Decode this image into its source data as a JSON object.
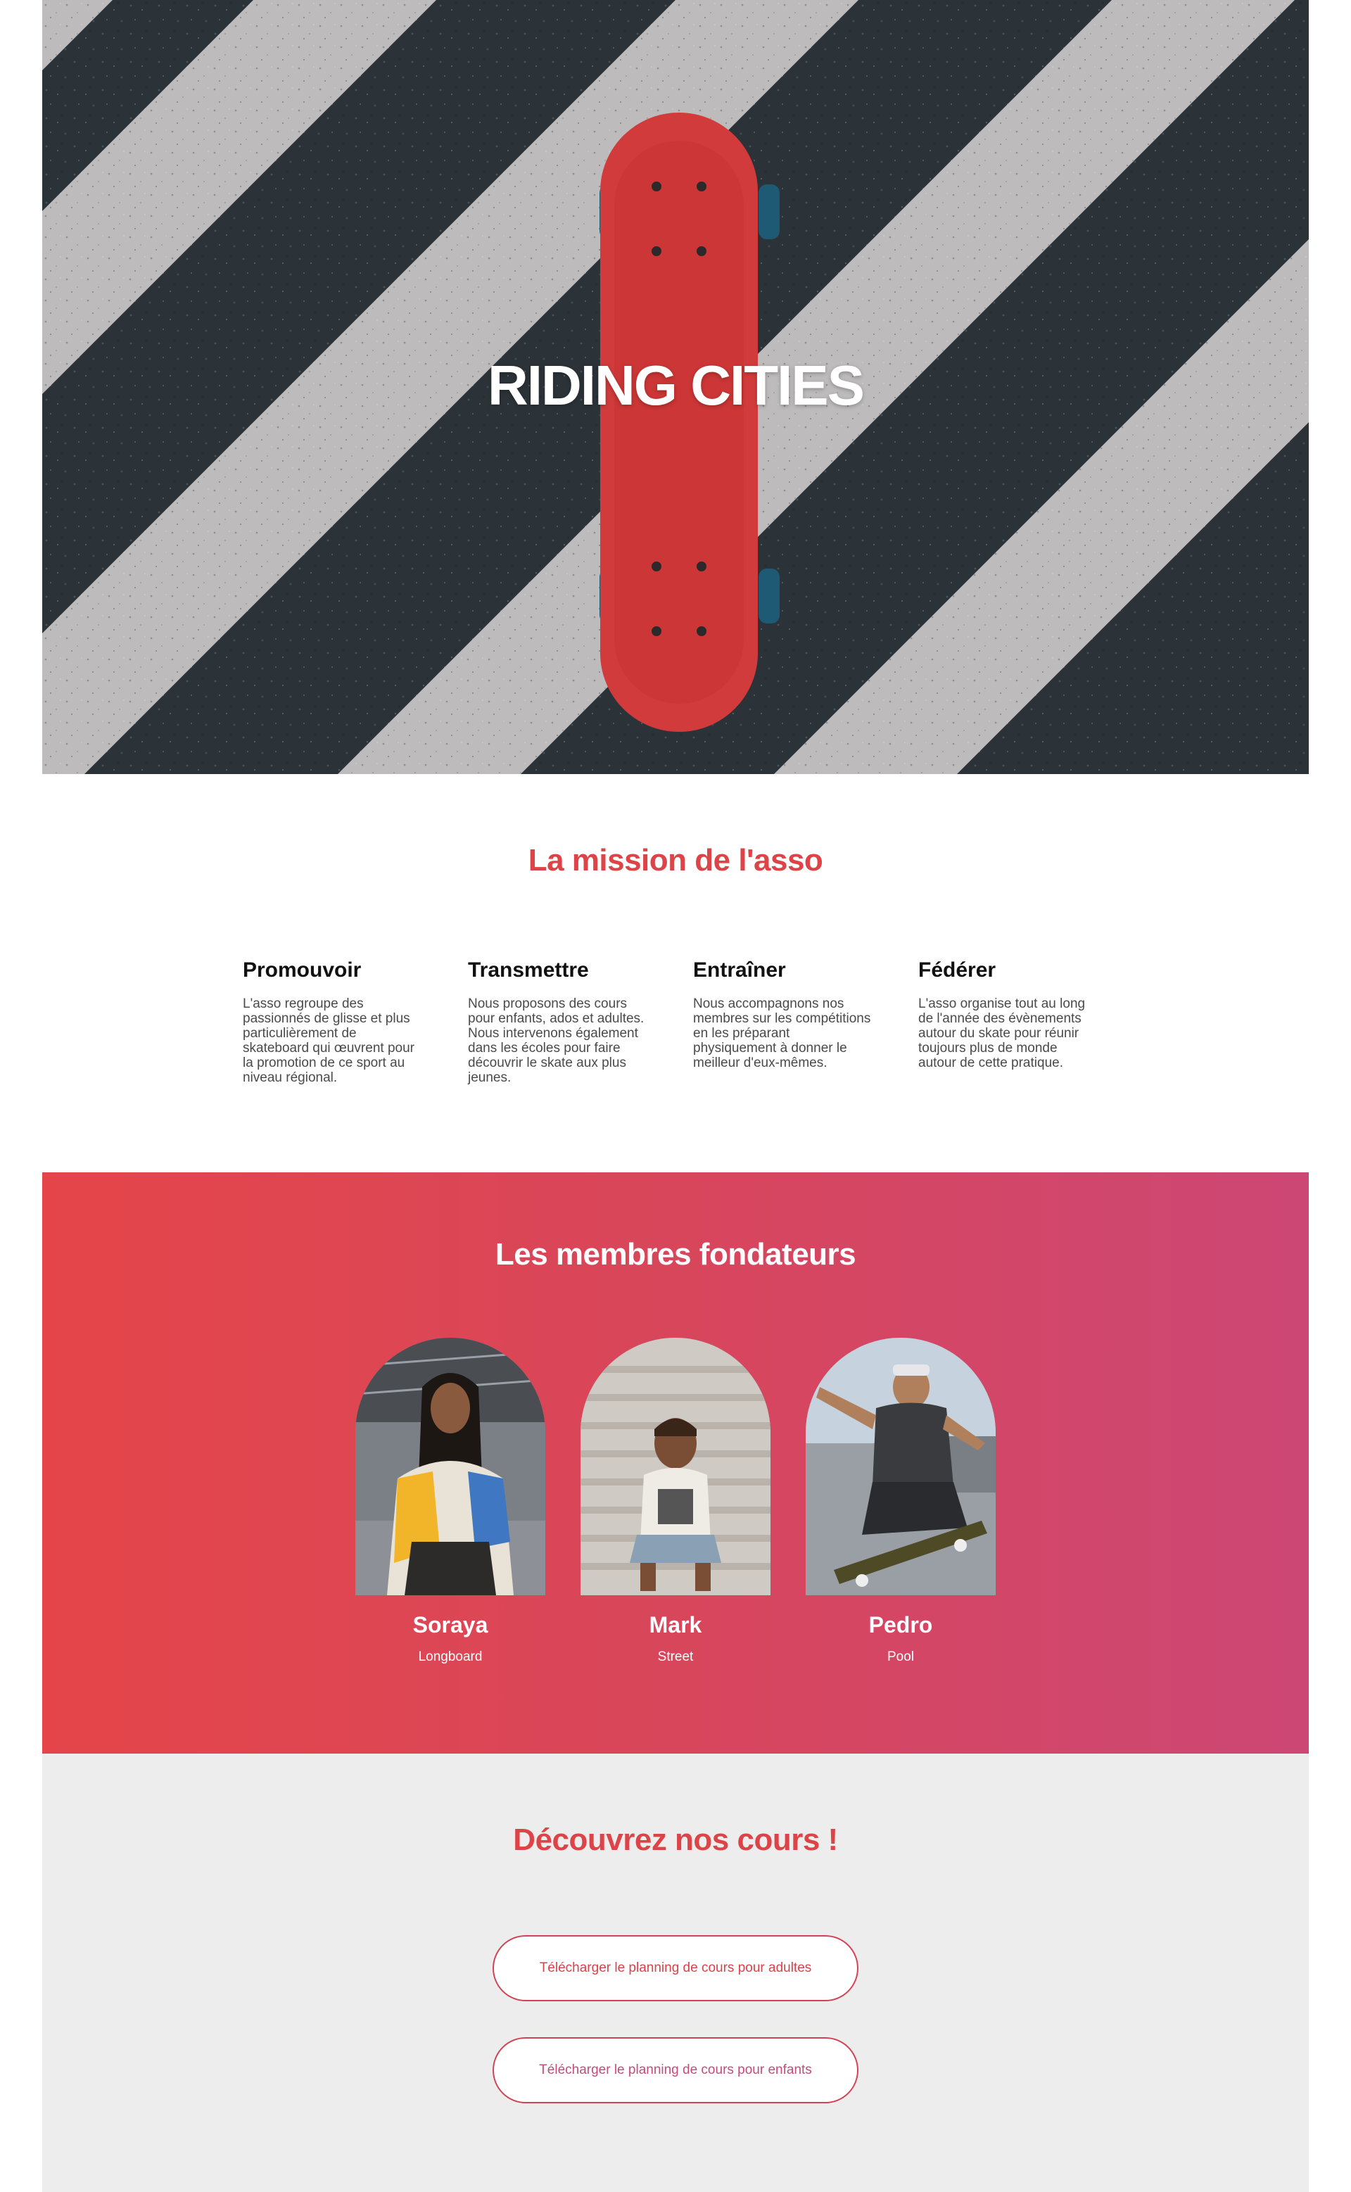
{
  "hero": {
    "title": "RIDING CITIES"
  },
  "mission": {
    "title": "La mission de l'asso",
    "pillars": [
      {
        "title": "Promouvoir",
        "text": "L'asso regroupe des passionnés de glisse et plus particulièrement de skateboard qui œuvrent pour la promotion de ce sport au niveau régional."
      },
      {
        "title": "Transmettre",
        "text": "Nous proposons des cours pour enfants, ados et adultes. Nous intervenons également dans les écoles pour faire découvrir le skate aux plus jeunes."
      },
      {
        "title": "Entraîner",
        "text": "Nous accompagnons nos membres sur les compétitions en les préparant physiquement à donner le meilleur d'eux-mêmes."
      },
      {
        "title": "Fédérer",
        "text": "L'asso organise tout au long de l'année des évènements autour du skate pour réunir toujours plus de monde autour de cette pratique."
      }
    ]
  },
  "founders": {
    "title": "Les membres fondateurs",
    "members": [
      {
        "name": "Soraya",
        "style": "Longboard"
      },
      {
        "name": "Mark",
        "style": "Street"
      },
      {
        "name": "Pedro",
        "style": "Pool"
      }
    ]
  },
  "courses": {
    "title": "Découvrez nos cours !",
    "buttons": [
      {
        "label": "Télécharger le planning de cours pour adultes"
      },
      {
        "label": "Télécharger le planning de cours pour enfants"
      }
    ]
  },
  "colors": {
    "accent_red": "#dc4448",
    "gradient_start": "#e54549",
    "gradient_end": "#cd4775",
    "courses_bg": "#eeeded"
  }
}
